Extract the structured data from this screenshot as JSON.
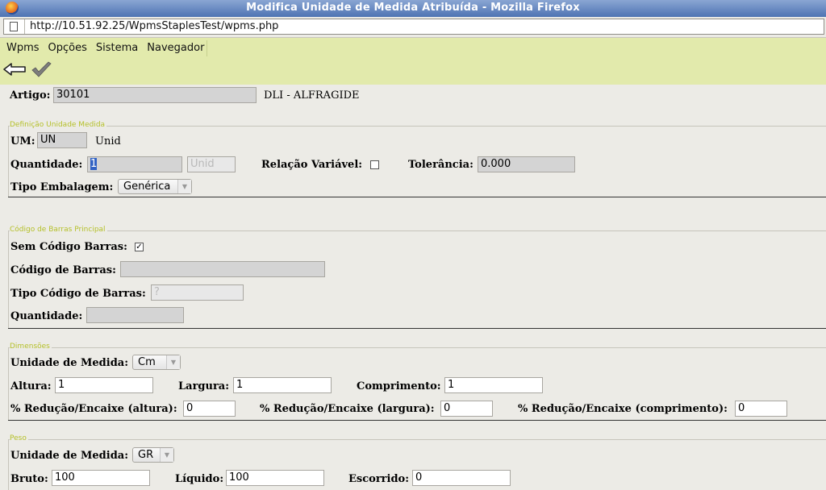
{
  "window": {
    "title": "Modifica Unidade de Medida Atribuída - Mozilla Firefox"
  },
  "browser": {
    "url": "http://10.51.92.25/WpmsStaplesTest/wpms.php"
  },
  "menu": {
    "items": [
      "Wpms",
      "Opções",
      "Sistema",
      "Navegador"
    ]
  },
  "toolbar": {
    "back_icon": "back-arrow-icon",
    "confirm_icon": "checkmark-icon"
  },
  "artigo": {
    "label": "Artigo:",
    "value": "30101",
    "store": "DLI - ALFRAGIDE"
  },
  "definicao": {
    "legend": "Definição Unidade Medida",
    "um_label": "UM:",
    "um_value": "UN",
    "um_desc": "Unid",
    "quantidade_label": "Quantidade:",
    "quantidade_value": "1",
    "quantidade_unit": "Unid",
    "relacao_label": "Relação Variável:",
    "relacao_checked": false,
    "tolerancia_label": "Tolerância:",
    "tolerancia_value": "0.000",
    "tipo_label": "Tipo Embalagem:",
    "tipo_value": "Genérica"
  },
  "codigo": {
    "legend": "Código de Barras Principal",
    "sem_label": "Sem Código Barras:",
    "sem_checked": true,
    "sem_mark": "✓",
    "codigo_label": "Código de Barras:",
    "codigo_value": "",
    "tipo_label": "Tipo Código de Barras:",
    "tipo_value": "?",
    "quantidade_label": "Quantidade:",
    "quantidade_value": ""
  },
  "dimensoes": {
    "legend": "Dimensões",
    "unidade_label": "Unidade de Medida:",
    "unidade_value": "Cm",
    "altura_label": "Altura:",
    "altura_value": "1",
    "largura_label": "Largura:",
    "largura_value": "1",
    "comprimento_label": "Comprimento:",
    "comprimento_value": "1",
    "red_altura_label": "% Redução/Encaixe (altura):",
    "red_altura_value": "0",
    "red_largura_label": "% Redução/Encaixe (largura):",
    "red_largura_value": "0",
    "red_comprimento_label": "% Redução/Encaixe (comprimento):",
    "red_comprimento_value": "0"
  },
  "peso": {
    "legend": "Peso",
    "unidade_label": "Unidade de Medida:",
    "unidade_value": "GR",
    "bruto_label": "Bruto:",
    "bruto_value": "100",
    "liquido_label": "Líquido:",
    "liquido_value": "100",
    "escorrido_label": "Escorrido:",
    "escorrido_value": "0"
  }
}
